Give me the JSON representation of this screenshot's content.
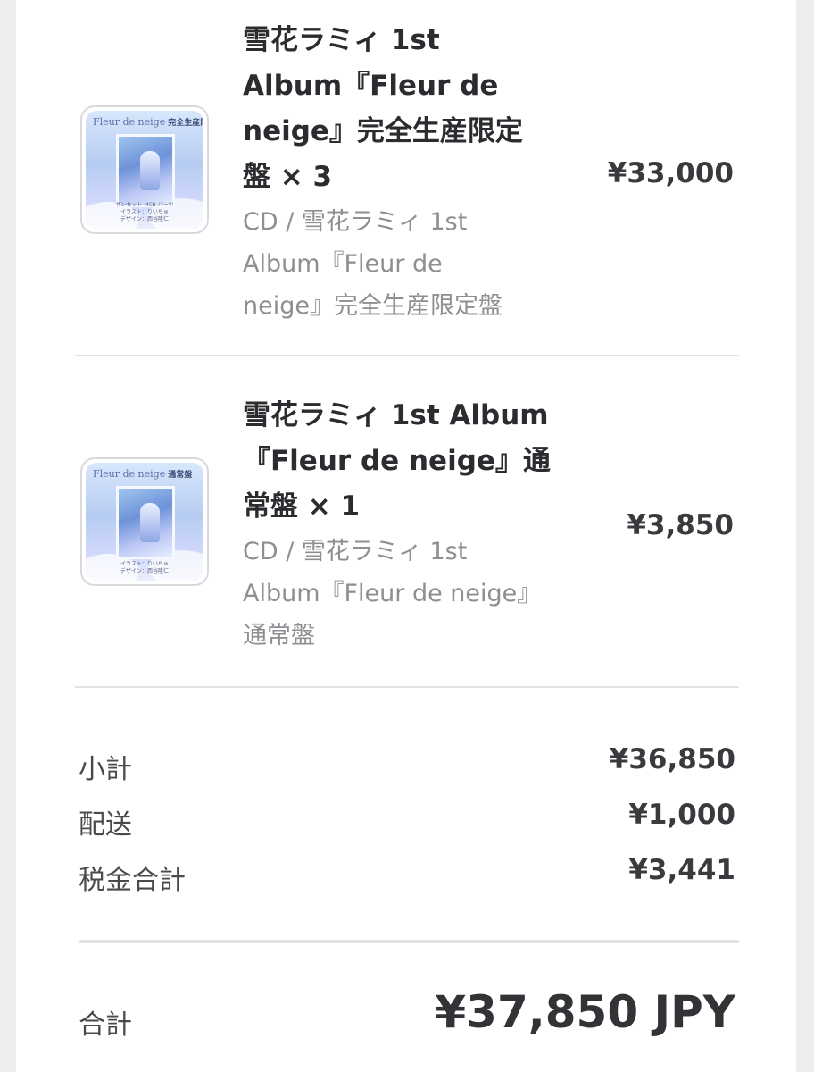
{
  "items": [
    {
      "title_lines": [
        "雪花ラミィ 1st",
        "Album『Fleur de",
        "neige』完全生産限定",
        "盤 × 3"
      ],
      "variant_lines": [
        "CD / 雪花ラミィ 1st",
        "Album『Fleur de",
        "neige』完全生産限定盤"
      ],
      "price": "¥33,000",
      "thumbnail": {
        "brand": "Fleur de neige",
        "edition_tag": "完全生産限定盤",
        "caption_lines": [
          "サンセット MCB パーツ",
          "イラスト：りいちゅ",
          "デザイン：西谷隆仁"
        ],
        "icon": "album-cover-icon"
      }
    },
    {
      "title_lines": [
        "雪花ラミィ 1st Album",
        "『Fleur de neige』通",
        "常盤 × 1"
      ],
      "variant_lines": [
        "CD / 雪花ラミィ 1st",
        "Album『Fleur de neige』",
        "通常盤"
      ],
      "price": "¥3,850",
      "thumbnail": {
        "brand": "Fleur de neige",
        "edition_tag": "通常盤",
        "caption_lines": [
          "イラスト：りいちゅ",
          "デザイン：西谷隆仁"
        ],
        "icon": "album-cover-icon"
      }
    }
  ],
  "summary": {
    "subtotal_label": "小計",
    "subtotal_value": "¥36,850",
    "shipping_label": "配送",
    "shipping_value": "¥1,000",
    "tax_label": "税金合計",
    "tax_value": "¥3,441"
  },
  "total": {
    "label": "合計",
    "value": "¥37,850 JPY"
  },
  "colors": {
    "page_background": "#eeeef1",
    "card_background": "#ffffff",
    "primary_text": "#2c2c30",
    "secondary_text": "#8e8e93",
    "divider": "#e4e4e8"
  }
}
